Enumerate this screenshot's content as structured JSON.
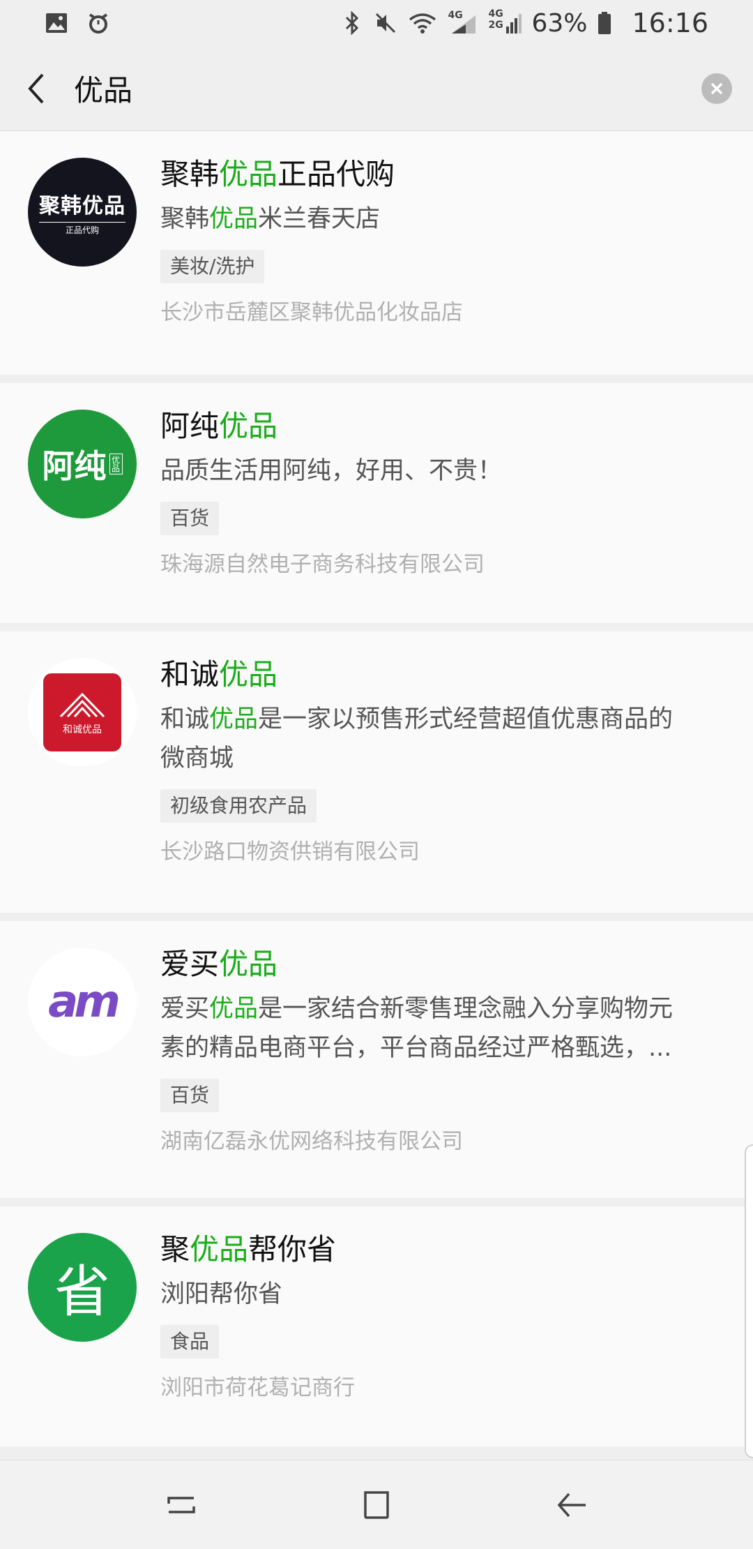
{
  "status_bar": {
    "battery": "63%",
    "time": "16:16",
    "network_labels": [
      "4G",
      "4G",
      "2G"
    ],
    "icons": [
      "image-icon",
      "alarm-icon",
      "bluetooth-icon",
      "mute-icon",
      "wifi-icon",
      "signal-icon",
      "battery-icon"
    ]
  },
  "header": {
    "query": "优品",
    "back_icon": "back-arrow-icon",
    "clear_icon": "clear-icon"
  },
  "accent_color": "#1aad19",
  "results": [
    {
      "name_parts": [
        "聚韩",
        "优品",
        "正品代购"
      ],
      "desc_parts": [
        "聚韩",
        "优品",
        "米兰春天店",
        ""
      ],
      "tag": "美妆/洗护",
      "company": "长沙市岳麓区聚韩优品化妆品店",
      "logo_text": "聚韩优品",
      "logo_subtext": "正品代购"
    },
    {
      "name_parts": [
        "阿纯",
        "优品",
        ""
      ],
      "desc_parts": [
        "品质生活用阿纯，好用、不贵！",
        "",
        "",
        ""
      ],
      "tag": "百货",
      "company": "珠海源自然电子商务科技有限公司",
      "logo_text": "阿纯",
      "logo_subtext": "优品"
    },
    {
      "name_parts": [
        "和诚",
        "优品",
        ""
      ],
      "desc_parts": [
        "和诚",
        "优品",
        "是一家以预售形式经营超值优惠商品的",
        "微商城"
      ],
      "tag": "初级食用农产品",
      "company": "长沙路口物资供销有限公司",
      "logo_text": "和诚优品",
      "logo_subtext": ""
    },
    {
      "name_parts": [
        "爱买",
        "优品",
        ""
      ],
      "desc_parts": [
        "爱买",
        "优品",
        "是一家结合新零售理念融入分享购物元",
        "素的精品电商平台，平台商品经过严格甄选，..."
      ],
      "tag": "百货",
      "company": "湖南亿磊永优网络科技有限公司",
      "logo_text": "am",
      "logo_subtext": ""
    },
    {
      "name_parts": [
        "聚",
        "优品",
        "帮你省"
      ],
      "desc_parts": [
        "浏阳帮你省",
        "",
        "",
        ""
      ],
      "tag": "食品",
      "company": "浏阳市荷花葛记商行",
      "logo_text": "省",
      "logo_subtext": ""
    }
  ],
  "nav_bar": {
    "icons": [
      "recent-apps-icon",
      "home-icon",
      "back-icon"
    ]
  }
}
